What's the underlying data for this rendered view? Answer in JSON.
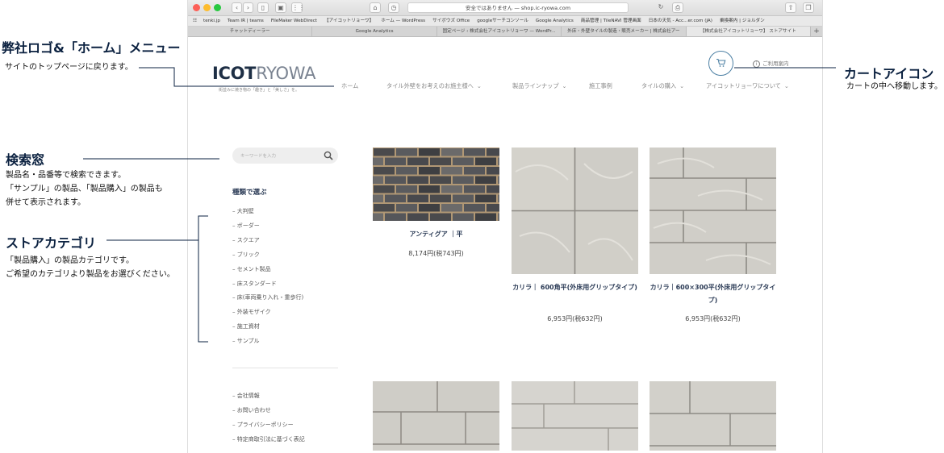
{
  "browser": {
    "url": "安全ではありません — shop.ic-ryowa.com",
    "bookmarks": [
      "tenki.jp",
      "Team IR | teams",
      "FileMaker WebDirect",
      "【アイコットリョーワ】",
      "ホーム — WordPress",
      "サイボウズ Office",
      "googleサーチコンソール",
      "Google Analytics",
      "商品管理 | TileNAVI 管理画面",
      "日本の天気 - Acc...er.com (JA)",
      "乗換案内 | ジョルダン"
    ],
    "tabs": [
      "チャットディーラー",
      "Google Analytics",
      "固定ページ ‹ 株式会社アイコットリョーワ — WordPr...",
      "外床・外壁タイルの製造・販売メーカー | 株式会社アー",
      "【株式会社アイコットリョーワ】 ストアサイト"
    ],
    "tab_add": "+"
  },
  "site": {
    "logo_bold": "ICOT",
    "logo_light": "RYOWA",
    "tagline": "街並みに焼き物の「趣き」と「美しさ」を。",
    "nav": [
      "ホーム",
      "タイル外壁をお考えのお施主様へ",
      "製品ラインナップ",
      "施工事例",
      "タイルの購入",
      "アイコットリョーワについて"
    ],
    "guide": "ご利用案内",
    "search_placeholder": "キーワードを入力",
    "sidebar_heading": "種類で選ぶ",
    "categories": [
      "大判壁",
      "ボーダー",
      "スクエア",
      "ブリック",
      "セメント製品",
      "床スタンダード",
      "床(車両乗り入れ・重歩行)",
      "外装モザイク",
      "施工資材",
      "サンプル"
    ],
    "footer_links": [
      "会社情報",
      "お問い合わせ",
      "プライバシーポリシー",
      "特定商取引法に基づく表記"
    ],
    "products": [
      {
        "name": "アンティグア ｜平",
        "price": "8,174円(税743円)"
      },
      {
        "name": "カリラ｜ 600角平(外床用グリップタイプ)",
        "price": "6,953円(税632円)"
      },
      {
        "name": "カリラ｜600×300平(外床用グリップタイプ)",
        "price": "6,953円(税632円)"
      }
    ]
  },
  "annotations": {
    "logo_title": "弊社ロゴ&「ホーム」メニュー",
    "logo_text": "サイトのトップページに戻ります。",
    "cart_title": "カートアイコン",
    "cart_text": "カートの中へ移動します。",
    "search_title": "検索窓",
    "search_text": [
      "製品名・品番等で検索できます。",
      "「サンプル」の製品、「製品購入」の製品も",
      "併せて表示されます。"
    ],
    "store_title": "ストアカテゴリ",
    "store_text": [
      "「製品購入」の製品カテゴリです。",
      "ご希望のカテゴリより製品をお選びください。"
    ]
  }
}
